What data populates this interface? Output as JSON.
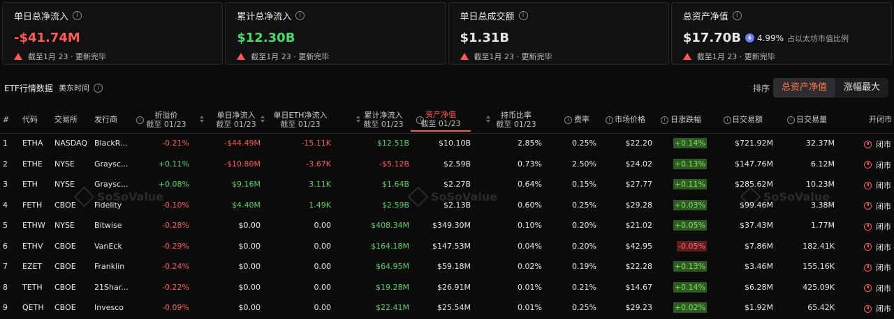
{
  "cards": [
    {
      "title": "单日总净流入",
      "value": "-$41.74M",
      "value_color": "red",
      "note": "截至1月 23 · 更新完毕"
    },
    {
      "title": "累计总净流入",
      "value": "$12.30B",
      "value_color": "green",
      "note": "截至1月 23 · 更新完毕"
    },
    {
      "title": "单日总成交额",
      "value": "$1.31B",
      "value_color": "white",
      "note": "截至1月 23 · 更新完毕"
    },
    {
      "title": "总资产净值",
      "value": "$17.70B",
      "value_color": "white",
      "pct": "4.99%",
      "pct_label": "占以太坊市值比例",
      "note": "截至1月 23 · 更新完毕"
    }
  ],
  "toolbar": {
    "title": "ETF行情数据",
    "timezone": "美东时间",
    "sort_label": "排序",
    "sort_options": [
      "总资产净值",
      "涨幅最大"
    ]
  },
  "headers": {
    "num": "#",
    "code": "代码",
    "exchange": "交易所",
    "issuer": "发行商",
    "premium": "折溢价",
    "daily_flow": "单日净流入",
    "daily_eth_flow": "单日ETH净流入",
    "cum_flow": "累计净流入",
    "nav": "资产净值",
    "share": "持币比率",
    "fee": "费率",
    "price": "市场价格",
    "change": "日涨跌幅",
    "volume_usd": "日交易额",
    "volume": "日交易量",
    "status": "开闭市",
    "as_of": "截至 01/23"
  },
  "rows": [
    {
      "num": "1",
      "code": "ETHA",
      "exchange": "NASDAQ",
      "issuer": "BlackR...",
      "premium": "-0.21%",
      "daily_flow": "-$44.49M",
      "daily_eth_flow": "-15.11K",
      "cum_flow": "$12.51B",
      "nav": "$10.10B",
      "share": "2.85%",
      "fee": "0.25%",
      "price": "$22.20",
      "change": "+0.14%",
      "volume_usd": "$721.92M",
      "volume": "32.37M",
      "status": "闭市"
    },
    {
      "num": "2",
      "code": "ETHE",
      "exchange": "NYSE",
      "issuer": "Graysc...",
      "premium": "+0.11%",
      "daily_flow": "-$10.80M",
      "daily_eth_flow": "-3.67K",
      "cum_flow": "-$5.12B",
      "nav": "$2.59B",
      "share": "0.73%",
      "fee": "2.50%",
      "price": "$24.02",
      "change": "+0.13%",
      "volume_usd": "$147.76M",
      "volume": "6.12M",
      "status": "闭市"
    },
    {
      "num": "3",
      "code": "ETH",
      "exchange": "NYSE",
      "issuer": "Graysc...",
      "premium": "+0.08%",
      "daily_flow": "$9.16M",
      "daily_eth_flow": "3.11K",
      "cum_flow": "$1.64B",
      "nav": "$2.27B",
      "share": "0.64%",
      "fee": "0.15%",
      "price": "$27.77",
      "change": "+0.11%",
      "volume_usd": "$285.62M",
      "volume": "10.23M",
      "status": "闭市"
    },
    {
      "num": "4",
      "code": "FETH",
      "exchange": "CBOE",
      "issuer": "Fidelity",
      "premium": "-0.10%",
      "daily_flow": "$4.40M",
      "daily_eth_flow": "1.49K",
      "cum_flow": "$2.59B",
      "nav": "$2.13B",
      "share": "0.60%",
      "fee": "0.25%",
      "price": "$29.28",
      "change": "+0.03%",
      "volume_usd": "$99.46M",
      "volume": "3.38M",
      "status": "闭市"
    },
    {
      "num": "5",
      "code": "ETHW",
      "exchange": "NYSE",
      "issuer": "Bitwise",
      "premium": "-0.28%",
      "daily_flow": "$0.00",
      "daily_eth_flow": "0.00",
      "cum_flow": "$408.34M",
      "nav": "$349.30M",
      "share": "0.10%",
      "fee": "0.20%",
      "price": "$21.02",
      "change": "+0.05%",
      "volume_usd": "$37.43M",
      "volume": "1.77M",
      "status": "闭市"
    },
    {
      "num": "6",
      "code": "ETHV",
      "exchange": "CBOE",
      "issuer": "VanEck",
      "premium": "-0.29%",
      "daily_flow": "$0.00",
      "daily_eth_flow": "0.00",
      "cum_flow": "$164.18M",
      "nav": "$147.53M",
      "share": "0.04%",
      "fee": "0.20%",
      "price": "$42.95",
      "change": "-0.05%",
      "volume_usd": "$7.86M",
      "volume": "182.41K",
      "status": "闭市"
    },
    {
      "num": "7",
      "code": "EZET",
      "exchange": "CBOE",
      "issuer": "Franklin",
      "premium": "-0.24%",
      "daily_flow": "$0.00",
      "daily_eth_flow": "0.00",
      "cum_flow": "$64.95M",
      "nav": "$59.18M",
      "share": "0.02%",
      "fee": "0.19%",
      "price": "$22.28",
      "change": "+0.13%",
      "volume_usd": "$3.46M",
      "volume": "155.16K",
      "status": "闭市"
    },
    {
      "num": "8",
      "code": "TETH",
      "exchange": "CBOE",
      "issuer": "21Shar...",
      "premium": "-0.22%",
      "daily_flow": "$0.00",
      "daily_eth_flow": "0.00",
      "cum_flow": "$19.28M",
      "nav": "$26.91M",
      "share": "0.01%",
      "fee": "0.21%",
      "price": "$14.67",
      "change": "+0.14%",
      "volume_usd": "$6.28M",
      "volume": "425.09K",
      "status": "闭市"
    },
    {
      "num": "9",
      "code": "QETH",
      "exchange": "CBOE",
      "issuer": "Invesco",
      "premium": "-0.09%",
      "daily_flow": "$0.00",
      "daily_eth_flow": "0.00",
      "cum_flow": "$22.41M",
      "nav": "$25.54M",
      "share": "0.01%",
      "fee": "0.25%",
      "price": "$29.23",
      "change": "+0.02%",
      "volume_usd": "$1.92M",
      "volume": "65.42K",
      "status": "闭市"
    }
  ],
  "watermark": "SoSoValue",
  "colors": {
    "red": "#ff5a4f",
    "green": "#4cd964",
    "accent": "#ff7a45"
  }
}
